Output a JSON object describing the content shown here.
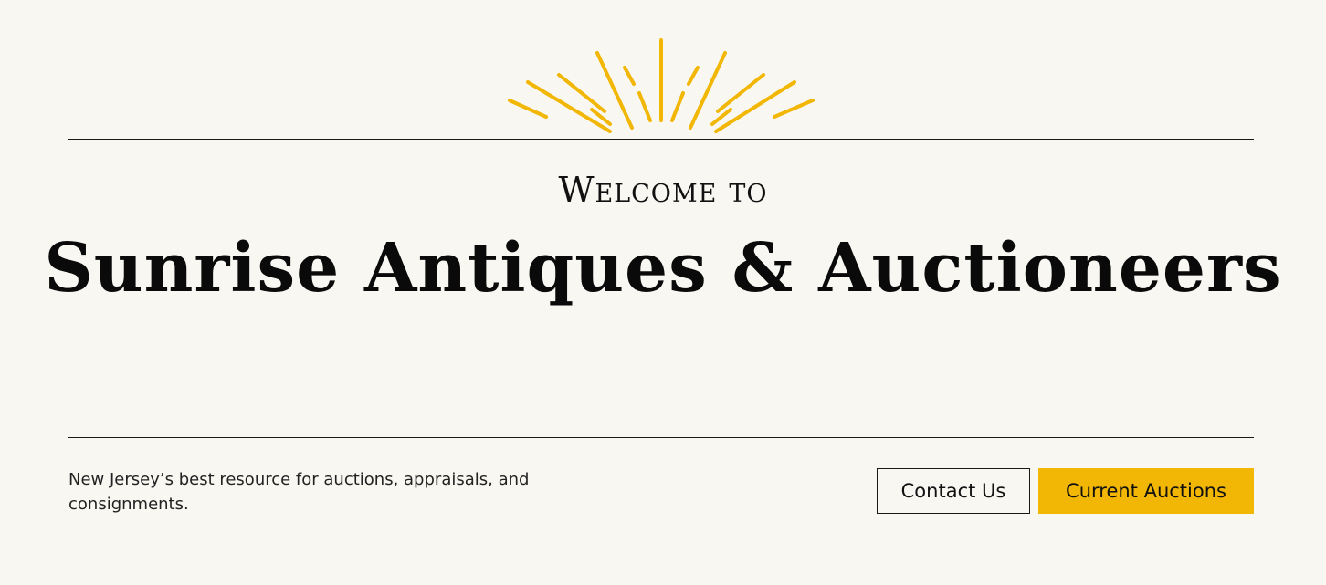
{
  "hero": {
    "welcome": "Welcome to",
    "title": "Sunrise Antiques & Auctioneers",
    "tagline": "New Jersey’s best resource for auctions, appraisals, and consignments."
  },
  "buttons": {
    "contact_label": "Contact Us",
    "auctions_label": "Current Auctions"
  },
  "decor": {
    "icon": "sunburst-icon",
    "accent_color": "#f2b705"
  }
}
